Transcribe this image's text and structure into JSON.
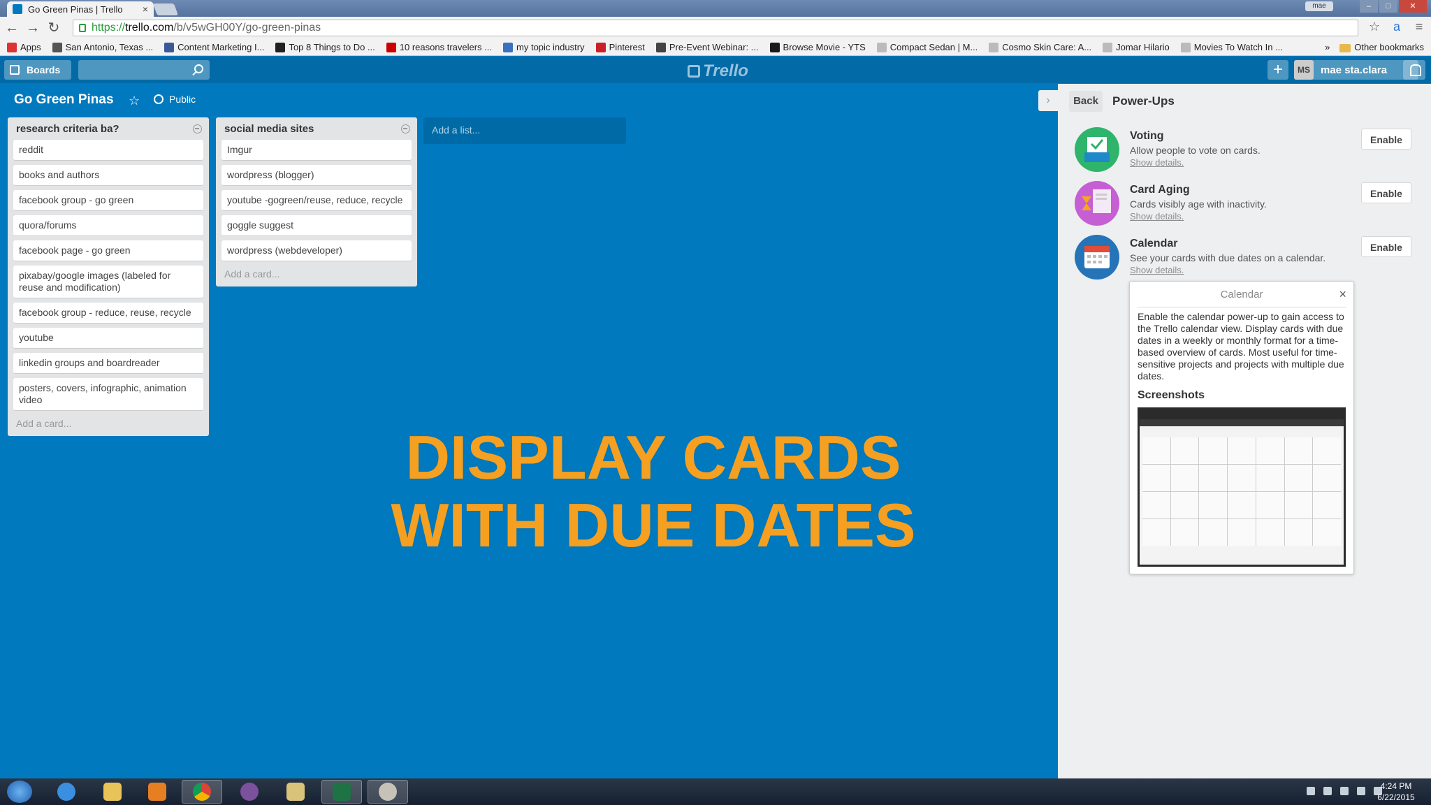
{
  "browser": {
    "tab_title": "Go Green Pinas | Trello",
    "tab_close": "×",
    "profile_name": "mae",
    "url_scheme": "https://",
    "url_host": "trello.com",
    "url_path": "/b/v5wGH00Y/go-green-pinas",
    "nav_back": "←",
    "nav_forward": "→",
    "nav_reload": "↻",
    "star": "☆",
    "menu": "≡",
    "bookmarks": [
      {
        "label": "Apps",
        "color": "#d33"
      },
      {
        "label": "San Antonio, Texas ...",
        "color": "#555"
      },
      {
        "label": "Content Marketing I...",
        "color": "#3b5998"
      },
      {
        "label": "Top 8 Things to Do ...",
        "color": "#222"
      },
      {
        "label": "10 reasons travelers ...",
        "color": "#c00"
      },
      {
        "label": "my topic industry",
        "color": "#3a6fc2"
      },
      {
        "label": "Pinterest",
        "color": "#cb2027"
      },
      {
        "label": "Pre-Event Webinar: ...",
        "color": "#444"
      },
      {
        "label": "Browse Movie - YTS",
        "color": "#1a1a1a"
      },
      {
        "label": "Compact Sedan | M...",
        "color": "#bbb"
      },
      {
        "label": "Cosmo Skin Care: A...",
        "color": "#bbb"
      },
      {
        "label": "Jomar Hilario",
        "color": "#bbb"
      },
      {
        "label": "Movies To Watch In ...",
        "color": "#bbb"
      }
    ],
    "bookmarks_more": "»",
    "other_bookmarks": "Other bookmarks"
  },
  "header": {
    "boards_label": "Boards",
    "logo_text": "Trello",
    "add": "+",
    "member_initials": "MS",
    "member_name": "mae sta.clara"
  },
  "board": {
    "title": "Go Green Pinas",
    "star": "☆",
    "visibility": "Public",
    "add_list": "Add a list..."
  },
  "lists": [
    {
      "name": "research criteria ba?",
      "cards": [
        "reddit",
        "books and authors",
        "facebook group - go green",
        "quora/forums",
        "facebook page - go green",
        "pixabay/google images (labeled for reuse and modification)",
        "facebook group - reduce, reuse, recycle",
        "youtube",
        "linkedin groups and boardreader",
        "posters, covers, infographic, animation video"
      ],
      "add_card": "Add a card..."
    },
    {
      "name": "social media sites",
      "cards": [
        "Imgur",
        "wordpress (blogger)",
        "youtube -gogreen/reuse, reduce, recycle",
        "goggle suggest",
        "wordpress (webdeveloper)"
      ],
      "add_card": "Add a card..."
    }
  ],
  "overlay": {
    "line1": "DISPLAY CARDS",
    "line2": "WITH DUE DATES",
    "color": "#f5a021"
  },
  "sidebar": {
    "collapse": "›",
    "back": "Back",
    "title": "Power-Ups",
    "powerups": [
      {
        "name": "Voting",
        "desc": "Allow people to vote on cards.",
        "link": "Show details.",
        "button": "Enable",
        "icon": "voting-icon",
        "color": "#2fb46b"
      },
      {
        "name": "Card Aging",
        "desc": "Cards visibly age with inactivity.",
        "link": "Show details.",
        "button": "Enable",
        "icon": "card-aging-icon",
        "color": "#c55fd3"
      },
      {
        "name": "Calendar",
        "desc": "See your cards with due dates on a calendar.",
        "link": "Show details.",
        "button": "Enable",
        "icon": "calendar-icon",
        "color": "#2574b8"
      }
    ],
    "detail": {
      "title": "Calendar",
      "close": "×",
      "body": "Enable the calendar power-up to gain access to the Trello calendar view. Display cards with due dates in a weekly or monthly format for a time-based overview of cards. Most useful for time-sensitive projects and projects with multiple due dates.",
      "screenshots_heading": "Screenshots"
    }
  },
  "taskbar": {
    "time": "4:24 PM",
    "date": "6/22/2015"
  }
}
